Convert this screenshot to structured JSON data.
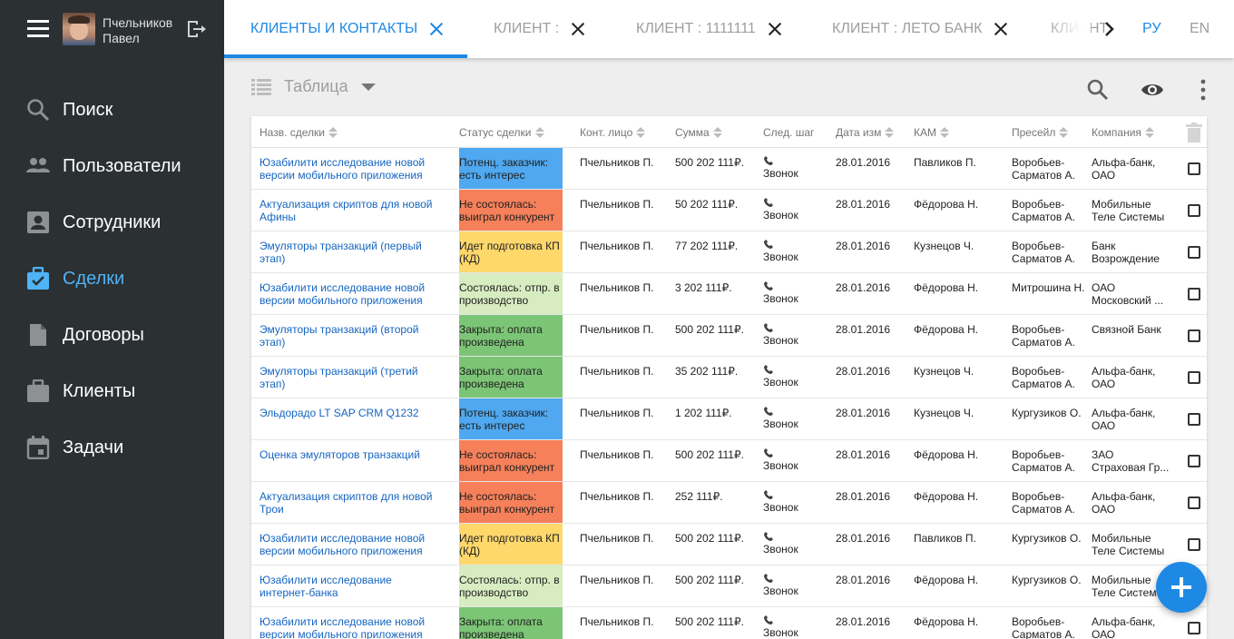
{
  "user": {
    "name_line1": "Пчельников",
    "name_line2": "Павел"
  },
  "menu": [
    {
      "id": "search",
      "label": "Поиск",
      "icon": "search-icon",
      "active": false
    },
    {
      "id": "users",
      "label": "Пользователи",
      "icon": "users-icon",
      "active": false
    },
    {
      "id": "employees",
      "label": "Сотрудники",
      "icon": "employee-icon",
      "active": false
    },
    {
      "id": "deals",
      "label": "Сделки",
      "icon": "briefcase-check-icon",
      "active": true
    },
    {
      "id": "contracts",
      "label": "Договоры",
      "icon": "document-icon",
      "active": false
    },
    {
      "id": "clients",
      "label": "Клиенты",
      "icon": "briefcase-icon",
      "active": false
    },
    {
      "id": "tasks",
      "label": "Задачи",
      "icon": "calendar-icon",
      "active": false
    }
  ],
  "tabs": [
    {
      "label": "КЛИЕНТЫ И КОНТАКТЫ",
      "active": true
    },
    {
      "label": "КЛИЕНТ :",
      "active": false
    },
    {
      "label": "КЛИЕНТ : 1111111",
      "active": false
    },
    {
      "label": "КЛИЕНТ : ЛЕТО БАНК",
      "active": false
    },
    {
      "label": "КЛИЕНТ",
      "active": false
    }
  ],
  "languages": [
    {
      "label": "РУ",
      "active": true
    },
    {
      "label": "EN",
      "active": false
    }
  ],
  "toolbar": {
    "view_label": "Таблица"
  },
  "colors": {
    "accent": "#1e88e5",
    "status_blue": "#4fa8f0",
    "status_red": "#f6805a",
    "status_yellow": "#ffd86c",
    "status_lightgreen": "#d7ecc0",
    "status_green": "#7cc576"
  },
  "table": {
    "headers": [
      "Назв. сделки",
      "Статус сделки",
      "Конт. лицо",
      "Сумма",
      "След. шаг",
      "Дата изм",
      "КАМ",
      "Пресейл",
      "Компания"
    ],
    "rows": [
      {
        "name": "Юзабилити исследование новой версии мобильного приложения",
        "status": "Потенц. заказчик: есть интерес",
        "status_color": "#4fa8f0",
        "contact": "Пчельников П.",
        "sum": "500 202 111₽.",
        "step": "Звонок",
        "date": "28.01.2016",
        "kam": "Павликов П.",
        "presale": "Воробьев-Сарматов А.",
        "company": [
          "Альфа-банк,",
          "ОАО"
        ]
      },
      {
        "name": "Актуализация скриптов для новой Афины",
        "status": "Не состоялась: выиграл конкурент",
        "status_color": "#f6805a",
        "contact": "Пчельников П.",
        "sum": "50 202 111₽.",
        "step": "Звонок",
        "date": "28.01.2016",
        "kam": "Фёдорова Н.",
        "presale": "Воробьев-Сарматов А.",
        "company": [
          "Мобильные",
          "Теле Системы"
        ]
      },
      {
        "name": "Эмуляторы транзакций (первый этап)",
        "status": "Идет подготовка КП (КД)",
        "status_color": "#ffd86c",
        "contact": "Пчельников П.",
        "sum": "77 202 111₽.",
        "step": "Звонок",
        "date": "28.01.2016",
        "kam": "Кузнецов Ч.",
        "presale": "Воробьев-Сарматов А.",
        "company": [
          "Банк",
          "Возрождение"
        ]
      },
      {
        "name": "Юзабилити исследование новой версии мобильного приложения",
        "status": "Состоялась: отпр. в производство",
        "status_color": "#d7ecc0",
        "contact": "Пчельников П.",
        "sum": "3 202 111₽.",
        "step": "Звонок",
        "date": "28.01.2016",
        "kam": "Фёдорова Н.",
        "presale": "Митрошина Н.",
        "company": [
          "ОАО",
          "Московский ..."
        ]
      },
      {
        "name": "Эмуляторы транзакций (второй этап)",
        "status": "Закрыта: оплата произведена",
        "status_color": "#7cc576",
        "contact": "Пчельников П.",
        "sum": "500 202 111₽.",
        "step": "Звонок",
        "date": "28.01.2016",
        "kam": "Фёдорова Н.",
        "presale": "Воробьев-Сарматов А.",
        "company": [
          "Связной Банк"
        ]
      },
      {
        "name": "Эмуляторы транзакций (третий этап)",
        "status": "Закрыта: оплата произведена",
        "status_color": "#7cc576",
        "contact": "Пчельников П.",
        "sum": "35 202 111₽.",
        "step": "Звонок",
        "date": "28.01.2016",
        "kam": "Кузнецов Ч.",
        "presale": "Воробьев-Сарматов А.",
        "company": [
          "Альфа-банк,",
          "ОАО"
        ]
      },
      {
        "name": "Эльдорадо LT SAP CRM Q1232",
        "status": "Потенц. заказчик: есть интерес",
        "status_color": "#4fa8f0",
        "contact": "Пчельников П.",
        "sum": "1 202 111₽.",
        "step": "Звонок",
        "date": "28.01.2016",
        "kam": "Кузнецов Ч.",
        "presale": "Кургузиков О.",
        "company": [
          "Альфа-банк,",
          "ОАО"
        ]
      },
      {
        "name": "Оценка эмуляторов транзакций",
        "status": "Не состоялась: выиграл конкурент",
        "status_color": "#f6805a",
        "contact": "Пчельников П.",
        "sum": "500 202 111₽.",
        "step": "Звонок",
        "date": "28.01.2016",
        "kam": "Фёдорова Н.",
        "presale": "Воробьев-Сарматов А.",
        "company": [
          "ЗАО",
          "Страховая Гр..."
        ]
      },
      {
        "name": "Актуализация скриптов для новой Трои",
        "status": "Не состоялась: выиграл конкурент",
        "status_color": "#f6805a",
        "contact": "Пчельников П.",
        "sum": "252 111₽.",
        "step": "Звонок",
        "date": "28.01.2016",
        "kam": "Фёдорова Н.",
        "presale": "Воробьев-Сарматов А.",
        "company": [
          "Альфа-банк,",
          "ОАО"
        ]
      },
      {
        "name": "Юзабилити исследование новой версии мобильного приложения",
        "status": "Идет подготовка КП (КД)",
        "status_color": "#ffd86c",
        "contact": "Пчельников П.",
        "sum": "500 202 111₽.",
        "step": "Звонок",
        "date": "28.01.2016",
        "kam": "Павликов П.",
        "presale": "Кургузиков О.",
        "company": [
          "Мобильные",
          "Теле Системы"
        ]
      },
      {
        "name": "Юзабилити исследование интернет-банка",
        "status": "Состоялась: отпр. в производство",
        "status_color": "#d7ecc0",
        "contact": "Пчельников П.",
        "sum": "500 202 111₽.",
        "step": "Звонок",
        "date": "28.01.2016",
        "kam": "Фёдорова Н.",
        "presale": "Кургузиков О.",
        "company": [
          "Мобильные",
          "Теле Систем..."
        ]
      },
      {
        "name": "Юзабилити исследование новой версии мобильного приложения",
        "status": "Закрыта: оплата произведена",
        "status_color": "#7cc576",
        "contact": "Пчельников П.",
        "sum": "500 202 111₽.",
        "step": "Звонок",
        "date": "28.01.2016",
        "kam": "Фёдорова Н.",
        "presale": "Воробьев-Сарматов А.",
        "company": [
          "Альфа-банк,",
          "ОАО"
        ]
      }
    ]
  }
}
